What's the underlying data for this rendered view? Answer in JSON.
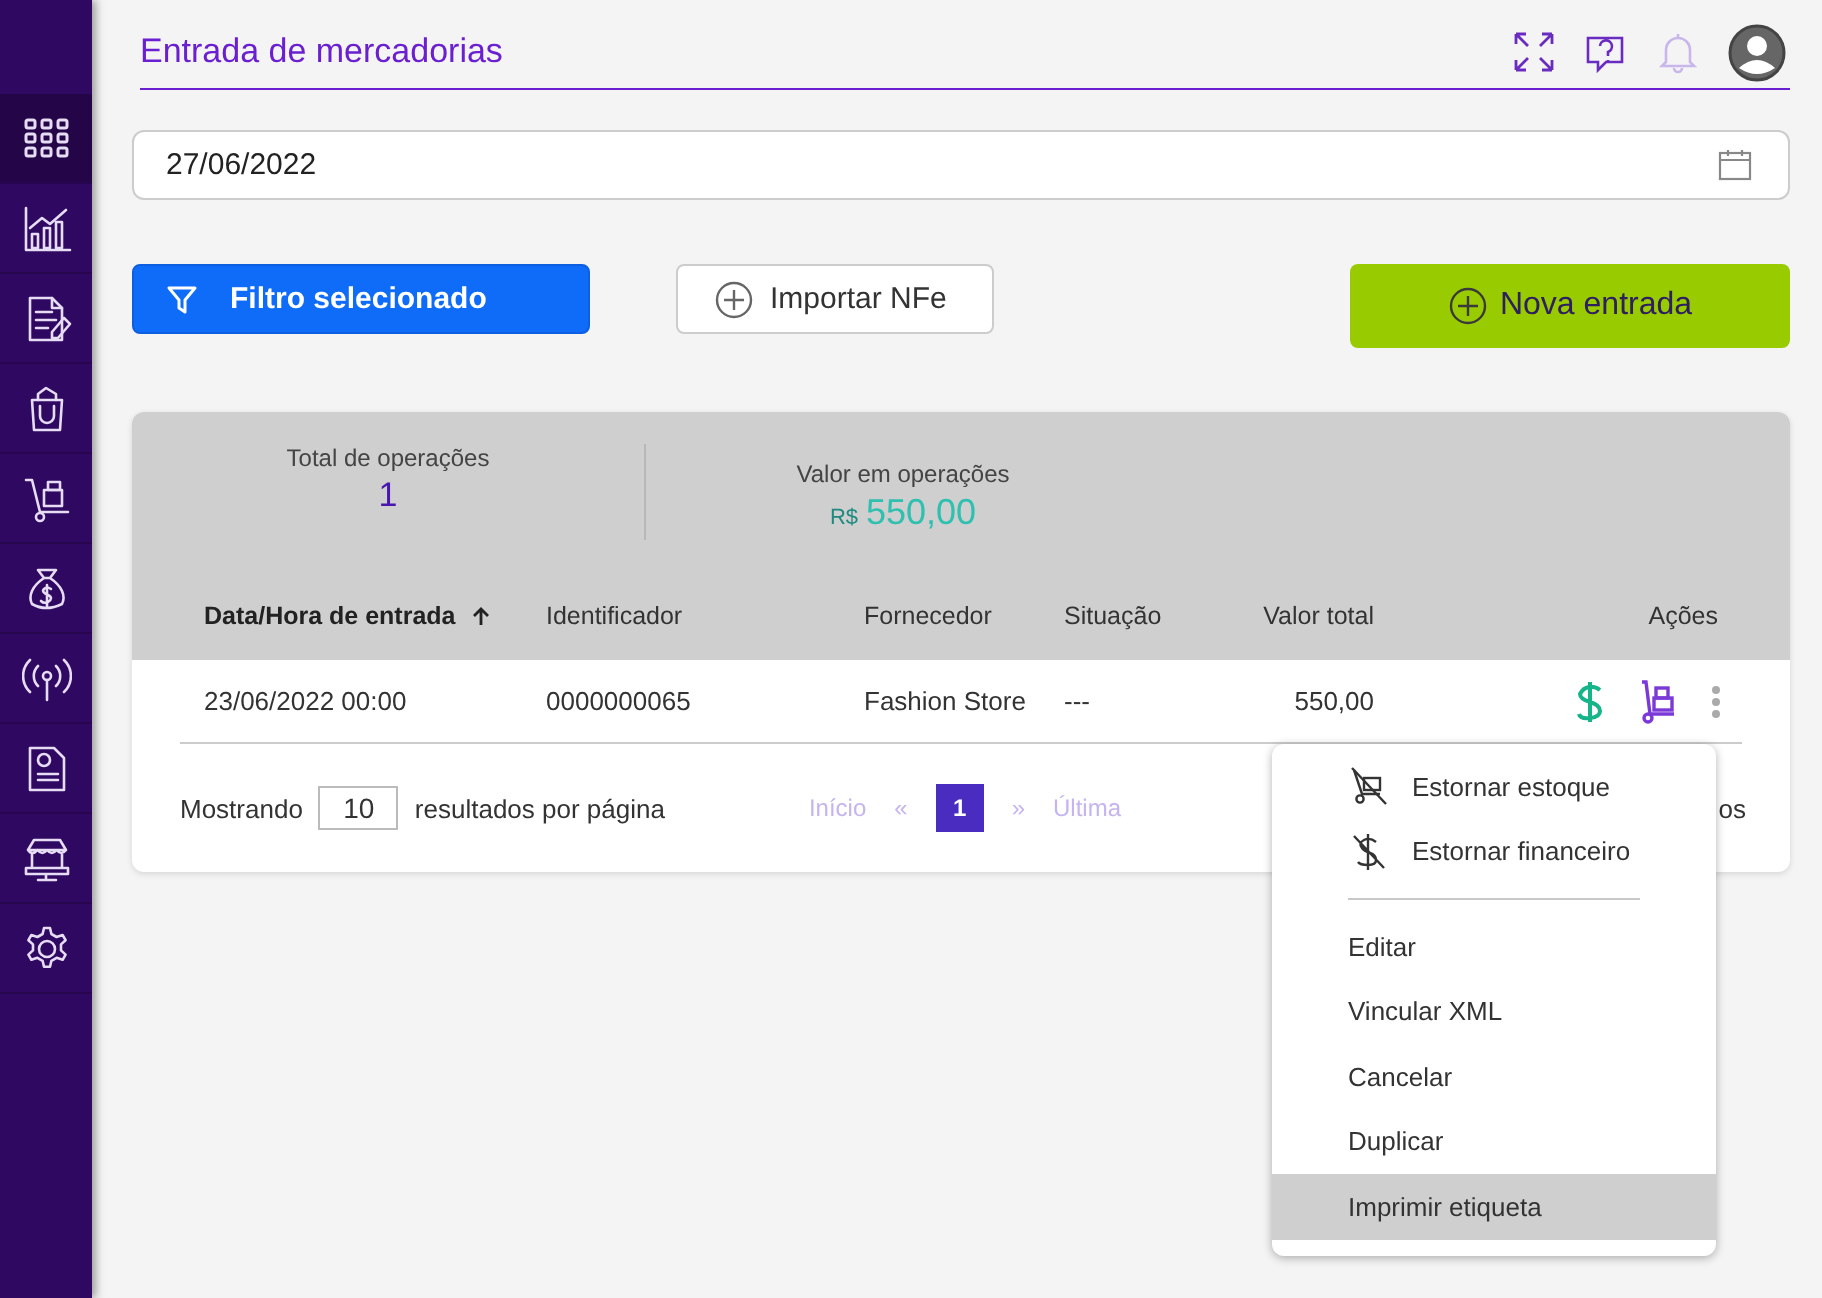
{
  "sidebar": {
    "items": [
      {
        "kind": "apps",
        "selected": true
      },
      {
        "kind": "chart",
        "selected": false
      },
      {
        "kind": "document-edit",
        "selected": false
      },
      {
        "kind": "bag",
        "selected": false
      },
      {
        "kind": "cart",
        "selected": false
      },
      {
        "kind": "money-bag",
        "selected": false
      },
      {
        "kind": "antenna",
        "selected": false
      },
      {
        "kind": "report",
        "selected": false
      },
      {
        "kind": "store",
        "selected": false
      },
      {
        "kind": "settings",
        "selected": false
      }
    ]
  },
  "header": {
    "title": "Entrada de mercadorias"
  },
  "date_field": {
    "value": "27/06/2022"
  },
  "buttons": [
    {
      "kind": "filter",
      "label": "Filtro selecionado"
    },
    {
      "kind": "import",
      "label": "Importar NFe"
    },
    {
      "kind": "new",
      "label": "Nova entrada"
    }
  ],
  "summary": [
    {
      "label": "Total de operações",
      "value": "1"
    },
    {
      "label": "Valor em operações",
      "currency": "R$",
      "value": "550,00"
    }
  ],
  "table": {
    "columns": [
      {
        "label": "Data/Hora de entrada",
        "sorted": true
      },
      {
        "label": "Identificador",
        "sorted": false
      },
      {
        "label": "Fornecedor",
        "sorted": false
      },
      {
        "label": "Situação",
        "sorted": false
      },
      {
        "label": "Valor total",
        "sorted": false
      },
      {
        "label": "Ações",
        "sorted": false
      }
    ],
    "rows": [
      {
        "cells": [
          "23/06/2022 00:00",
          "0000000065",
          "Fashion Store",
          "---",
          "550,00"
        ]
      }
    ]
  },
  "pagination": {
    "prefix": "Mostrando",
    "page_size": "10",
    "suffix": "resultados por página",
    "first": "Início",
    "prev": "«",
    "pages": [
      {
        "label": "1",
        "selected": true
      }
    ],
    "next": "»",
    "last": "Última",
    "summary": "os"
  },
  "menu": {
    "icon_items": [
      {
        "kind": "stock",
        "label": "Estornar estoque"
      },
      {
        "kind": "finance",
        "label": "Estornar financeiro"
      }
    ],
    "items": [
      {
        "label": "Editar",
        "selected": false
      },
      {
        "label": "Vincular XML",
        "selected": false
      },
      {
        "label": "Cancelar",
        "selected": false
      },
      {
        "label": "Duplicar",
        "selected": false
      },
      {
        "label": "Imprimir etiqueta",
        "selected": true
      }
    ]
  }
}
